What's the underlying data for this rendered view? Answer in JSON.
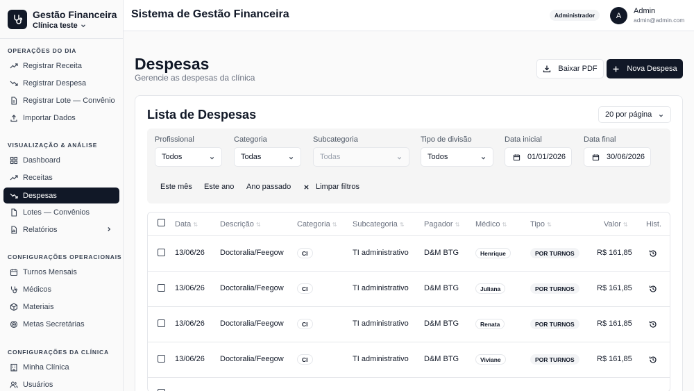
{
  "brand": {
    "name": "Gestão Financeira",
    "clinic": "Clínica teste"
  },
  "sidebar": {
    "sections": [
      {
        "title": "OPERAÇÕES DO DIA",
        "items": [
          {
            "label": "Registrar Receita",
            "icon": "trend-up-icon"
          },
          {
            "label": "Registrar Despesa",
            "icon": "trend-down-icon"
          },
          {
            "label": "Registrar Lote — Convênio",
            "icon": "document-icon"
          },
          {
            "label": "Importar Dados",
            "icon": "upload-icon"
          }
        ]
      },
      {
        "title": "VISUALIZAÇÃO & ANÁLISE",
        "items": [
          {
            "label": "Dashboard",
            "icon": "grid-icon"
          },
          {
            "label": "Receitas",
            "icon": "trend-up-icon"
          },
          {
            "label": "Despesas",
            "icon": "trend-down-icon",
            "active": true
          },
          {
            "label": "Lotes — Convênios",
            "icon": "file-icon"
          },
          {
            "label": "Relatórios",
            "icon": "report-icon"
          }
        ]
      },
      {
        "title": "CONFIGURAÇÕES OPERACIONAIS",
        "items": [
          {
            "label": "Turnos Mensais",
            "icon": "calendar-icon"
          },
          {
            "label": "Médicos",
            "icon": "stethoscope-icon"
          },
          {
            "label": "Materiais",
            "icon": "box-icon"
          },
          {
            "label": "Metas Secretárias",
            "icon": "target-icon"
          }
        ]
      },
      {
        "title": "CONFIGURAÇÕES DA CLÍNICA",
        "items": [
          {
            "label": "Minha Clínica",
            "icon": "building-icon"
          },
          {
            "label": "Usuários",
            "icon": "users-icon"
          }
        ]
      }
    ]
  },
  "topbar": {
    "title": "Sistema de Gestão Financeira",
    "role": "Administrador",
    "avatar_initial": "A",
    "user_name": "Admin",
    "user_email": "admin@admin.com"
  },
  "page": {
    "title": "Despesas",
    "subtitle": "Gerencie as despesas da clínica",
    "pdf_button": "Baixar PDF",
    "new_button": "Nova Despesa"
  },
  "list": {
    "title": "Lista de Despesas",
    "per_page": "20 por página"
  },
  "filters": {
    "profissional": {
      "label": "Profissional",
      "value": "Todos"
    },
    "categoria": {
      "label": "Categoria",
      "value": "Todas"
    },
    "subcategoria": {
      "label": "Subcategoria",
      "value": "Todas"
    },
    "tipo_divisao": {
      "label": "Tipo de divisão",
      "value": "Todos"
    },
    "data_inicial": {
      "label": "Data inicial",
      "value": "01/01/2026"
    },
    "data_final": {
      "label": "Data final",
      "value": "30/06/2026"
    },
    "quick": {
      "this_month": "Este mês",
      "this_year": "Este ano",
      "last_year": "Ano passado",
      "clear": "Limpar filtros"
    }
  },
  "table": {
    "headers": {
      "data": "Data",
      "descricao": "Descrição",
      "categoria": "Categoria",
      "subcategoria": "Subcategoria",
      "pagador": "Pagador",
      "medico": "Médico",
      "tipo": "Tipo",
      "valor": "Valor",
      "hist": "Hist."
    },
    "rows": [
      {
        "data": "13/06/26",
        "descricao": "Doctoralia/Feegow",
        "categoria": "CI",
        "subcategoria": "TI administrativo",
        "pagador": "D&M BTG",
        "medico": "Henrique",
        "tipo": "POR TURNOS",
        "valor": "R$ 161,85"
      },
      {
        "data": "13/06/26",
        "descricao": "Doctoralia/Feegow",
        "categoria": "CI",
        "subcategoria": "TI administrativo",
        "pagador": "D&M BTG",
        "medico": "Juliana",
        "tipo": "POR TURNOS",
        "valor": "R$ 161,85"
      },
      {
        "data": "13/06/26",
        "descricao": "Doctoralia/Feegow",
        "categoria": "CI",
        "subcategoria": "TI administrativo",
        "pagador": "D&M BTG",
        "medico": "Renata",
        "tipo": "POR TURNOS",
        "valor": "R$ 161,85"
      },
      {
        "data": "13/06/26",
        "descricao": "Doctoralia/Feegow",
        "categoria": "CI",
        "subcategoria": "TI administrativo",
        "pagador": "D&M BTG",
        "medico": "Viviane",
        "tipo": "POR TURNOS",
        "valor": "R$ 161,85"
      }
    ]
  },
  "colors": {
    "primary": "#111827",
    "border": "#e5e7eb",
    "muted": "#6b7280",
    "filter_bg": "#f5f5f5"
  }
}
